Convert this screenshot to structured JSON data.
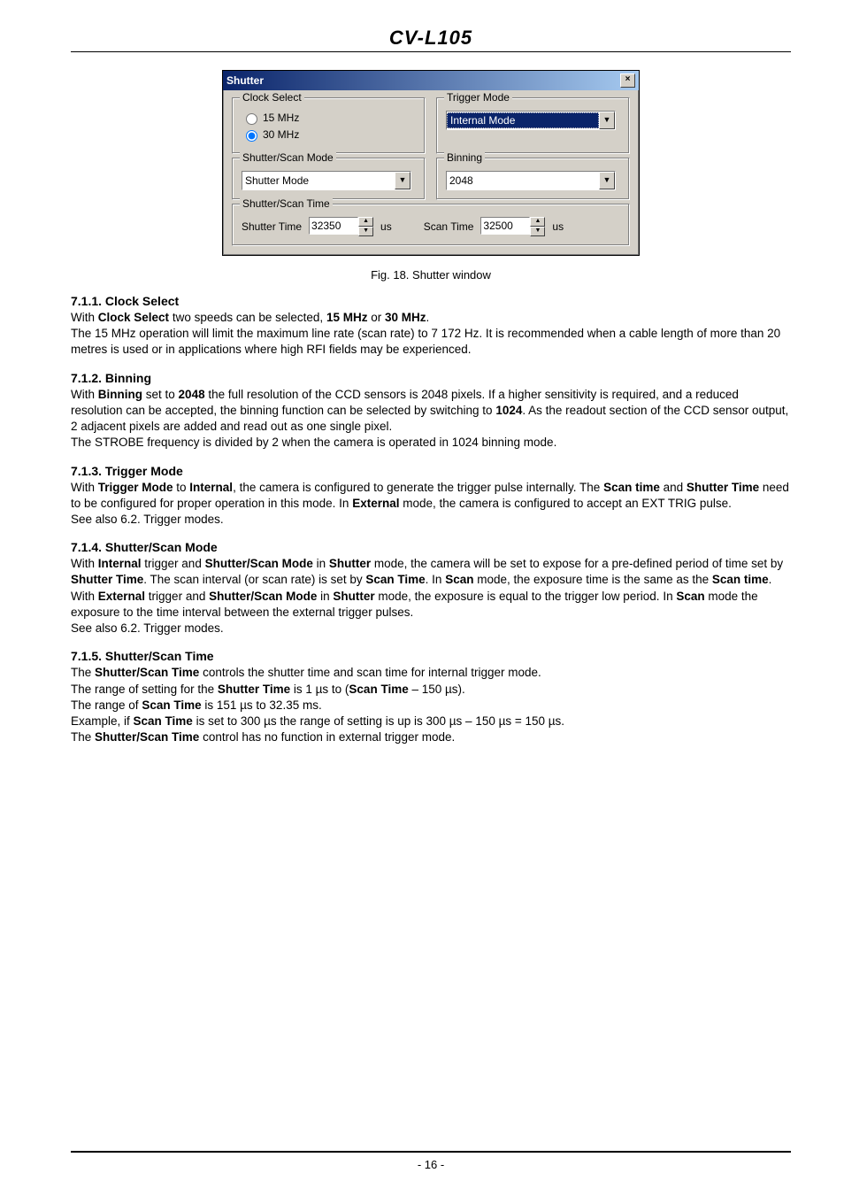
{
  "header": {
    "title": "CV-L105"
  },
  "dialog": {
    "title": "Shutter",
    "close": "×",
    "clock_select": {
      "legend": "Clock Select",
      "opt1": "15 MHz",
      "opt2": "30 MHz"
    },
    "trigger_mode": {
      "legend": "Trigger Mode",
      "value": "Internal Mode"
    },
    "shutter_scan_mode": {
      "legend": "Shutter/Scan Mode",
      "value": "Shutter Mode"
    },
    "binning": {
      "legend": "Binning",
      "value": "2048"
    },
    "shutter_scan_time": {
      "legend": "Shutter/Scan Time",
      "shutter_label": "Shutter Time",
      "shutter_value": "32350",
      "shutter_unit": "us",
      "scan_label": "Scan Time",
      "scan_value": "32500",
      "scan_unit": "us"
    }
  },
  "caption": "Fig. 18. Shutter window",
  "sections": {
    "s1": {
      "head": "7.1.1. Clock Select",
      "l1a": "With ",
      "l1b": "Clock Select",
      "l1c": " two speeds can be selected, ",
      "l1d": "15 MHz",
      "l1e": " or ",
      "l1f": "30 MHz",
      "l1g": ".",
      "l2": "The 15 MHz operation will limit the maximum line rate (scan rate) to 7 172 Hz.  It is recommended when a cable length of more than 20 metres is used or in applications where high RFI fields may be experienced."
    },
    "s2": {
      "head": "7.1.2. Binning",
      "l1a": "With ",
      "l1b": "Binning",
      "l1c": " set to ",
      "l1d": "2048",
      "l1e": " the full resolution of the CCD sensors is 2048 pixels. If a higher sensitivity is required, and a reduced resolution can be accepted, the binning function can be selected by switching to ",
      "l1f": "1024",
      "l1g": ". As the readout section of the CCD sensor output, 2 adjacent pixels are added and read out as one single pixel.",
      "l2": "The STROBE frequency is divided by 2 when the camera is operated in 1024 binning mode."
    },
    "s3": {
      "head": "7.1.3. Trigger Mode",
      "l1a": "With ",
      "l1b": "Trigger Mode",
      "l1c": " to ",
      "l1d": "Internal",
      "l1e": ", the camera is configured to generate the trigger pulse internally. The ",
      "l1f": "Scan time",
      "l1g": " and ",
      "l1h": "Shutter Time",
      "l1i": " need to be configured for proper operation in this mode. In ",
      "l1j": "External",
      "l1k": " mode, the camera is configured to accept an EXT TRIG pulse.",
      "l2": "See also 6.2. Trigger modes."
    },
    "s4": {
      "head": "7.1.4. Shutter/Scan Mode",
      "l1a": "With ",
      "l1b": "Internal",
      "l1c": " trigger and ",
      "l1d": "Shutter/Scan Mode",
      "l1e": " in ",
      "l1f": "Shutter",
      "l1g": " mode, the camera will be set to expose for a pre-defined period of time set by ",
      "l1h": "Shutter Time",
      "l1i": ". The scan interval (or scan rate) is set by ",
      "l1j": "Scan Time",
      "l1k": ". In ",
      "l1l": "Scan",
      "l1m": " mode, the exposure time is the same as the ",
      "l1n": "Scan time",
      "l1o": ".",
      "l2a": "With ",
      "l2b": "External",
      "l2c": " trigger and ",
      "l2d": "Shutter/Scan Mode",
      "l2e": " in ",
      "l2f": "Shutter",
      "l2g": " mode, the exposure is equal to the trigger low period. In ",
      "l2h": "Scan",
      "l2i": " mode the exposure to the time interval between the external trigger pulses.",
      "l3": "See also 6.2. Trigger modes."
    },
    "s5": {
      "head": "7.1.5. Shutter/Scan Time",
      "l1a": "The ",
      "l1b": "Shutter/Scan Time",
      "l1c": " controls the shutter time and scan time for internal trigger mode.",
      "l2a": "The range of setting for the ",
      "l2b": "Shutter Time",
      "l2c": " is 1 µs to (",
      "l2d": "Scan Time",
      "l2e": " – 150 µs).",
      "l3a": "The range of ",
      "l3b": "Scan Time",
      "l3c": " is 151 µs to 32.35 ms.",
      "l4a": "Example, if ",
      "l4b": "Scan Time",
      "l4c": " is set to 300 µs the range of setting is up is 300 µs – 150 µs = 150 µs.",
      "l5a": "The ",
      "l5b": "Shutter/Scan Time",
      "l5c": " control has no function in external trigger mode."
    }
  },
  "footer": {
    "page": "- 16 -"
  }
}
